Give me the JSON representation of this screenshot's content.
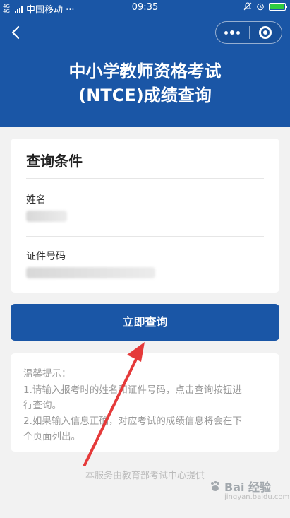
{
  "status_bar": {
    "network": "4G 4G",
    "carrier": "中国移动 ···",
    "time": "09:35"
  },
  "header": {
    "title_line1": "中小学教师资格考试",
    "title_line2": "(NTCE)成绩查询",
    "back_icon": "chevron-left-icon",
    "more_icon": "more-dots-icon",
    "close_icon": "target-close-icon"
  },
  "form": {
    "title": "查询条件",
    "name_label": "姓名",
    "id_label": "证件号码"
  },
  "query_button_label": "立即查询",
  "tips": {
    "heading": "温馨提示：",
    "lines": [
      "1.请输入报考时的姓名和证件号码，点击查询按钮进",
      "行查询。",
      "2.如果输入信息正确，对应考试的成绩信息将会在下",
      "个页面列出。"
    ]
  },
  "footer": "本服务由教育部考试中心提供",
  "watermark": {
    "text": "Bai 经验",
    "sub": "jingyan.baidu.com"
  },
  "colors": {
    "brand_blue": "#1a56a6",
    "annotation_red": "#e53a3a",
    "background": "#f2f2f2"
  }
}
